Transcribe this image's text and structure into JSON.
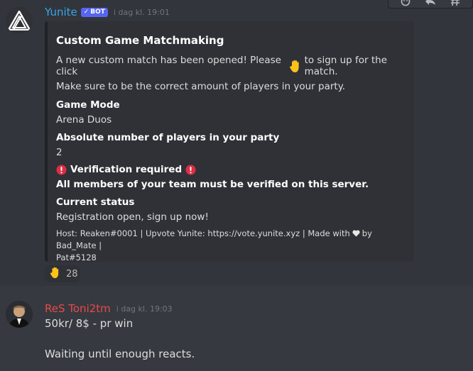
{
  "message1": {
    "author": "Yunite",
    "badge": "BOT",
    "timestamp": "i dag kl. 19:01",
    "embed": {
      "title": "Custom Game Matchmaking",
      "description_before": "A new custom match has been opened! Please click",
      "description_after": "to sign up for the match.",
      "description_line2": "Make sure to be the correct amount of players in your party.",
      "fields": [
        {
          "name": "Game Mode",
          "value": "Arena Duos"
        },
        {
          "name": "Absolute number of players in your party",
          "value": "2"
        },
        {
          "name": "Verification required",
          "value": "All members of your team must be verified on this server."
        },
        {
          "name": "Current status",
          "value": "Registration open, sign up now!"
        }
      ],
      "footer_before": "Host: Reaken#0001 | Upvote Yunite: https://vote.yunite.xyz | Made with",
      "footer_after": "by Bad_Mate |",
      "footer_line2": "Pat#5128"
    },
    "reaction": {
      "emoji": "raised-hand",
      "count": "28"
    }
  },
  "message2": {
    "author": "ReS Toni2tm",
    "timestamp": "i dag kl. 19:03",
    "lines": [
      "50kr/ 8$ - pr win",
      "Waiting until enough reacts."
    ]
  },
  "colors": {
    "background": "#36393f",
    "bot_author": "#3aa4e8",
    "user_author": "#e84a4a",
    "bot_badge": "#5865f2",
    "embed_bg": "#2f3136"
  }
}
